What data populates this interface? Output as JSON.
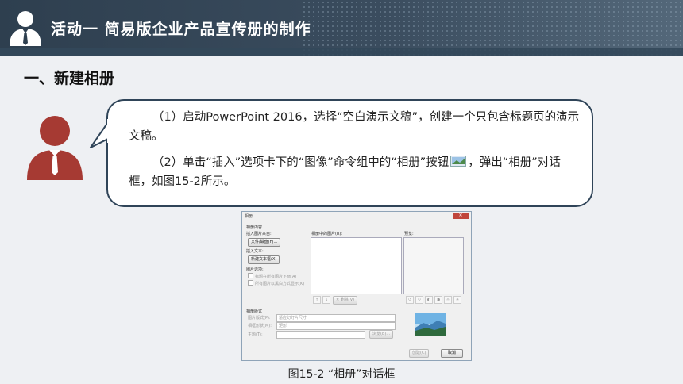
{
  "header": {
    "title": "活动一  简易版企业产品宣传册的制作"
  },
  "section": {
    "title": "一、新建相册"
  },
  "bubble": {
    "p1": "（1）启动PowerPoint 2016，选择“空白演示文稿”，创建一个只包含标题页的演示文稿。",
    "p2a": "（2）单击“插入”选项卡下的“图像”命令组中的“相册”按钮",
    "p2b": "，弹出“相册”对话框，如图15-2所示。"
  },
  "dialog": {
    "title": "相册",
    "close": "✕",
    "album_content": "相册内容",
    "insert_from": "插入图片来自:",
    "file_disk": "文件/磁盘(F)...",
    "insert_text": "插入文本:",
    "new_textbox": "新建文本框(X)",
    "picture_options": "图片选项:",
    "caption_below": "标题在所有图片下面(A)",
    "all_bw": "所有图片以黑白方式显示(K)",
    "pictures_in_album": "相册中的图片(R):",
    "preview": "预览:",
    "remove": "删除(V)",
    "album_layout": "相册版式",
    "picture_layout": "图片版式(P):",
    "picture_layout_value": "适应幻灯片尺寸",
    "frame_shape": "相框形状(M):",
    "frame_shape_value": "矩形",
    "theme": "主题(T):",
    "browse": "浏览(B)...",
    "create": "创建(C)",
    "cancel": "取消"
  },
  "caption": "图15-2  “相册”对话框",
  "colors": {
    "header_bg": "#2e3f4f",
    "avatar_red": "#a63a33",
    "bubble_border": "#2f4458"
  }
}
